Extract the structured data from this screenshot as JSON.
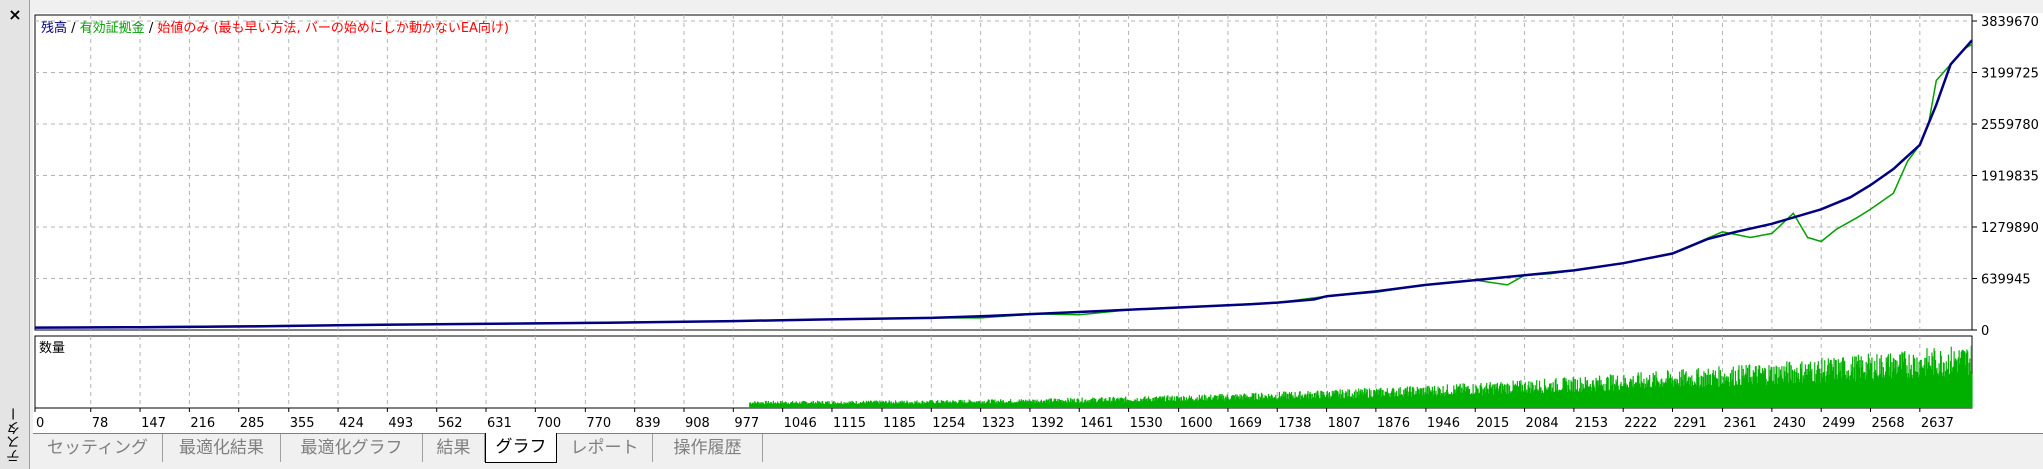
{
  "window": {
    "close_label": "×",
    "side_label": "テスター"
  },
  "legend": {
    "balance": "残高",
    "sep1": " / ",
    "equity": "有効証拠金",
    "sep2": " / ",
    "mode": "始値のみ (最も早い方法, バーの始めにしか動かないEA向け)"
  },
  "volume_label": "数量",
  "colors": {
    "balance": "#000080",
    "equity": "#00a000",
    "mode": "#ff0000",
    "grid": "#b4b4b4",
    "volume": "#00b000"
  },
  "tabs": [
    {
      "label": "セッティング",
      "active": false
    },
    {
      "label": "最適化結果",
      "active": false
    },
    {
      "label": "最適化グラフ",
      "active": false
    },
    {
      "label": "結果",
      "active": false
    },
    {
      "label": "グラフ",
      "active": true
    },
    {
      "label": "レポート",
      "active": false
    },
    {
      "label": "操作履歴",
      "active": false
    }
  ],
  "chart_data": {
    "type": "line",
    "y_ticks": [
      "3839670",
      "3199725",
      "2559780",
      "1919835",
      "1279890",
      "639945",
      "0"
    ],
    "y_values": [
      3839670,
      3199725,
      2559780,
      1919835,
      1279890,
      639945,
      0
    ],
    "ylim": [
      0,
      3839670
    ],
    "x_ticks": [
      "0",
      "78",
      "147",
      "216",
      "285",
      "355",
      "424",
      "493",
      "562",
      "631",
      "700",
      "770",
      "839",
      "908",
      "977",
      "1046",
      "1115",
      "1185",
      "1254",
      "1323",
      "1392",
      "1461",
      "1530",
      "1600",
      "1669",
      "1738",
      "1807",
      "1876",
      "1946",
      "2015",
      "2084",
      "2153",
      "2222",
      "2291",
      "2361",
      "2430",
      "2499",
      "2568",
      "2637"
    ],
    "xlim": [
      0,
      2710
    ],
    "series": [
      {
        "name": "残高",
        "points": [
          [
            0,
            30000
          ],
          [
            150,
            35000
          ],
          [
            300,
            45000
          ],
          [
            424,
            60000
          ],
          [
            600,
            75000
          ],
          [
            800,
            90000
          ],
          [
            977,
            110000
          ],
          [
            1100,
            130000
          ],
          [
            1254,
            150000
          ],
          [
            1323,
            170000
          ],
          [
            1400,
            200000
          ],
          [
            1500,
            240000
          ],
          [
            1600,
            280000
          ],
          [
            1700,
            320000
          ],
          [
            1738,
            340000
          ],
          [
            1790,
            380000
          ],
          [
            1807,
            420000
          ],
          [
            1876,
            480000
          ],
          [
            1946,
            560000
          ],
          [
            2015,
            620000
          ],
          [
            2084,
            680000
          ],
          [
            2153,
            740000
          ],
          [
            2222,
            830000
          ],
          [
            2291,
            950000
          ],
          [
            2340,
            1130000
          ],
          [
            2380,
            1220000
          ],
          [
            2430,
            1320000
          ],
          [
            2499,
            1500000
          ],
          [
            2540,
            1650000
          ],
          [
            2568,
            1800000
          ],
          [
            2600,
            2000000
          ],
          [
            2637,
            2300000
          ],
          [
            2660,
            2800000
          ],
          [
            2680,
            3300000
          ],
          [
            2700,
            3500000
          ],
          [
            2710,
            3600000
          ]
        ]
      },
      {
        "name": "有効証拠金",
        "points": [
          [
            0,
            30000
          ],
          [
            424,
            60000
          ],
          [
            977,
            110000
          ],
          [
            1254,
            150000
          ],
          [
            1323,
            150000
          ],
          [
            1400,
            200000
          ],
          [
            1461,
            190000
          ],
          [
            1530,
            250000
          ],
          [
            1738,
            340000
          ],
          [
            1807,
            420000
          ],
          [
            1876,
            470000
          ],
          [
            1946,
            560000
          ],
          [
            2015,
            620000
          ],
          [
            2060,
            560000
          ],
          [
            2084,
            680000
          ],
          [
            2120,
            700000
          ],
          [
            2153,
            740000
          ],
          [
            2222,
            830000
          ],
          [
            2291,
            950000
          ],
          [
            2361,
            1220000
          ],
          [
            2400,
            1150000
          ],
          [
            2430,
            1200000
          ],
          [
            2460,
            1450000
          ],
          [
            2480,
            1150000
          ],
          [
            2499,
            1100000
          ],
          [
            2520,
            1250000
          ],
          [
            2550,
            1400000
          ],
          [
            2568,
            1500000
          ],
          [
            2600,
            1700000
          ],
          [
            2620,
            2100000
          ],
          [
            2637,
            2300000
          ],
          [
            2650,
            2600000
          ],
          [
            2660,
            3100000
          ],
          [
            2680,
            3300000
          ],
          [
            2700,
            3500000
          ],
          [
            2710,
            3550000
          ]
        ]
      }
    ],
    "volume_max": 1
  }
}
